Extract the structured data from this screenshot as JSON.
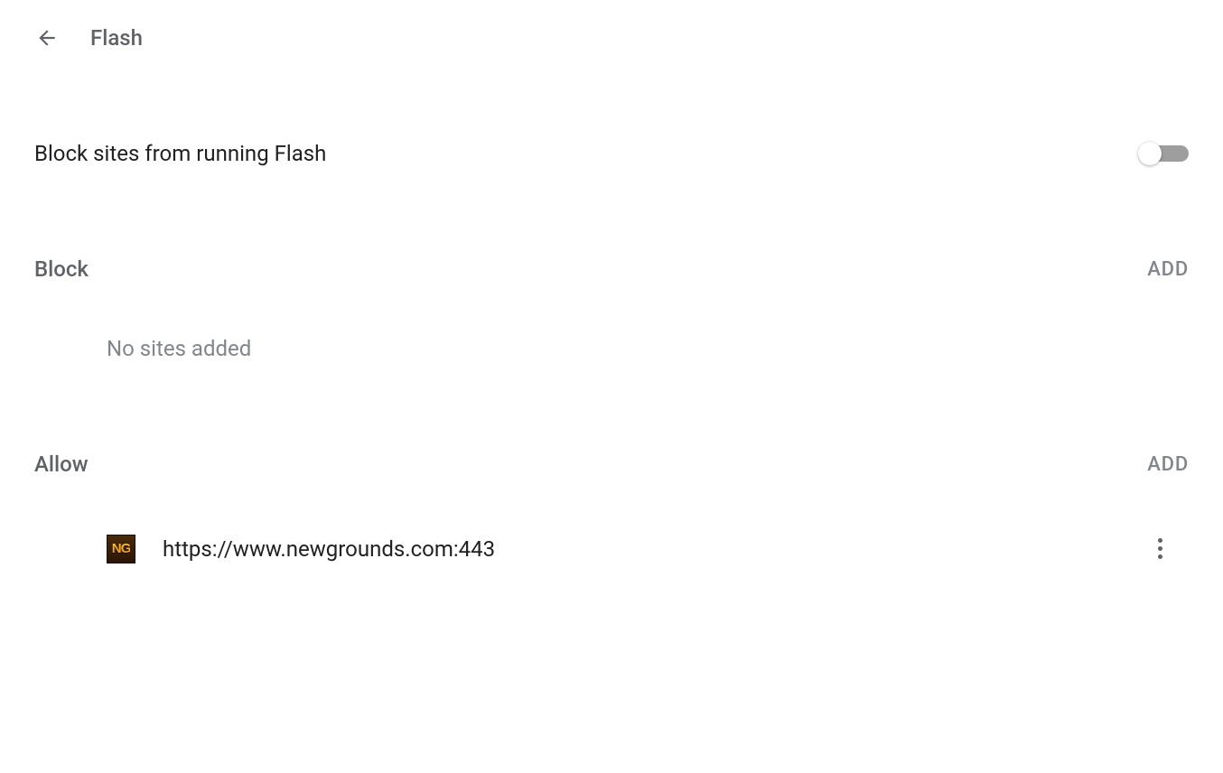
{
  "header": {
    "title": "Flash"
  },
  "setting": {
    "label": "Block sites from running Flash",
    "enabled": false
  },
  "sections": {
    "block": {
      "title": "Block",
      "add_label": "ADD",
      "empty_text": "No sites added",
      "sites": []
    },
    "allow": {
      "title": "Allow",
      "add_label": "ADD",
      "sites": [
        {
          "url": "https://www.newgrounds.com:443",
          "favicon_text": "NG"
        }
      ]
    }
  }
}
